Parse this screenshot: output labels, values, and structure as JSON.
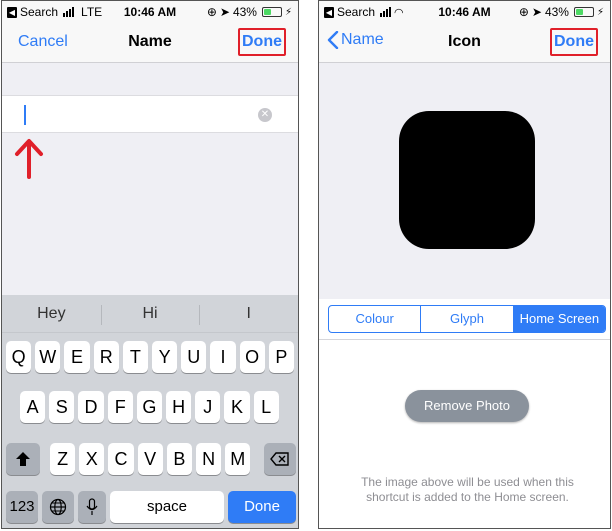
{
  "left_screen": {
    "status": {
      "back_app": "Search",
      "carrier": "LTE",
      "time": "10:46 AM",
      "battery": "43%",
      "battery_level": 0.43
    },
    "nav": {
      "cancel": "Cancel",
      "title": "Name",
      "done": "Done"
    },
    "text_field": {
      "value": ""
    },
    "keyboard": {
      "suggestions": [
        "Hey",
        "Hi",
        "I"
      ],
      "row1": [
        "Q",
        "W",
        "E",
        "R",
        "T",
        "Y",
        "U",
        "I",
        "O",
        "P"
      ],
      "row2": [
        "A",
        "S",
        "D",
        "F",
        "G",
        "H",
        "J",
        "K",
        "L"
      ],
      "row3": [
        "Z",
        "X",
        "C",
        "V",
        "B",
        "N",
        "M"
      ],
      "numbers": "123",
      "space": "space",
      "done": "Done"
    }
  },
  "right_screen": {
    "status": {
      "back_app": "Search",
      "time": "10:46 AM",
      "battery": "43%",
      "battery_level": 0.43
    },
    "nav": {
      "back": "Name",
      "title": "Icon",
      "done": "Done"
    },
    "segments": [
      "Colour",
      "Glyph",
      "Home Screen"
    ],
    "selected_segment": "Home Screen",
    "remove_photo": "Remove Photo",
    "caption": "The image above will be used when this shortcut is added to the Home screen."
  },
  "colors": {
    "accent": "#2f7cf6",
    "highlight_outline": "#e0202a",
    "icon_fill": "#000000"
  }
}
